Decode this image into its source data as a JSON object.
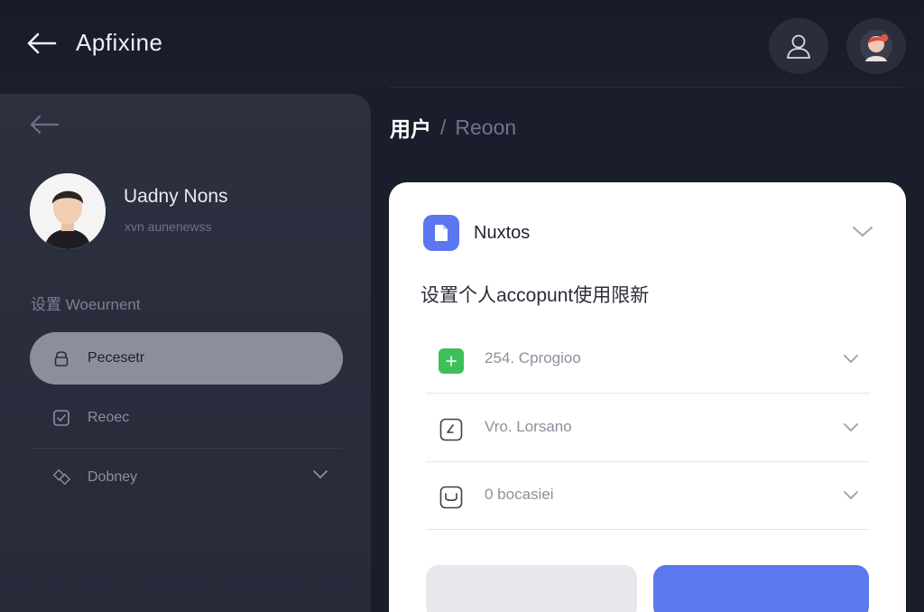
{
  "app": {
    "title": "Apfixine"
  },
  "header": {
    "icons": {
      "back": "arrow-left-icon",
      "user": "user-icon",
      "avatar": "avatar-icon"
    }
  },
  "sidebar": {
    "profile": {
      "name": "Uadny Nons",
      "subtitle": "xvn aunenewss"
    },
    "section_label": "设置 Woeurnent",
    "items": [
      {
        "label": "Pecesetr",
        "icon": "lock-icon",
        "active": true
      },
      {
        "label": "Reoec",
        "icon": "checkbox-icon",
        "active": false
      },
      {
        "label": "Dobney",
        "icon": "tag-icon",
        "active": false,
        "has_chevron": true
      }
    ]
  },
  "breadcrumb": {
    "current": "用户",
    "separator": "/",
    "next": "Reoon"
  },
  "card": {
    "title": "Nuxtos",
    "subtitle": "设置个人accopunt使用限新",
    "rows": [
      {
        "label": "254. Cprogioo",
        "icon": "plus-square-icon"
      },
      {
        "label": "Vro. Lorsano",
        "icon": "edit-square-icon"
      },
      {
        "label": "0 bocasiei",
        "icon": "message-square-icon"
      }
    ],
    "buttons": {
      "secondary_label": "",
      "primary_label": ""
    }
  },
  "colors": {
    "background": "#1a1d2c",
    "sidebar": "#2c303f",
    "active_item": "#8c8f9a",
    "accent_blue": "#5b79ec",
    "accent_green": "#3fbf5a"
  }
}
